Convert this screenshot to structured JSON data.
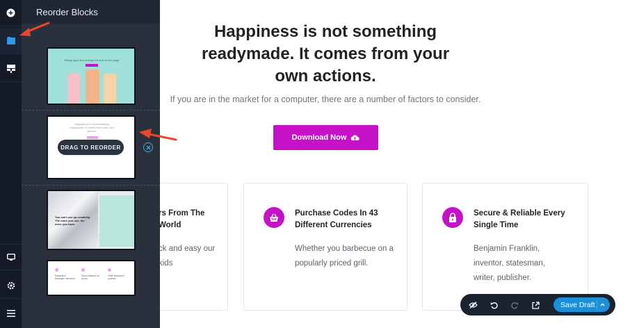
{
  "panel": {
    "title": "Reorder Blocks",
    "drag_label": "DRAG TO REORDER",
    "thumb1": {
      "headline": "Simply type and change the text on the page"
    },
    "thumb2": {
      "headline": "Happiness is not something readymade. It comes from your own actions."
    },
    "thumb3": {
      "headline": "You can't use up creativity. The more you use, the more you have."
    },
    "thumb4": {
      "items": [
        "Marketers Manager elements",
        "Show Alliance to prove",
        "Offer sustained policies"
      ]
    }
  },
  "rail": {
    "icons": [
      "add-icon",
      "blocks-icon",
      "layout-icon",
      "desktop-icon",
      "settings-icon",
      "menu-icon"
    ]
  },
  "main": {
    "headline": "Happiness is not something readymade. It comes from your own actions.",
    "subline": "If you are in the market for a computer, there are a number of factors to consider.",
    "download_label": "Download Now",
    "cards": [
      {
        "title": "rs From The World",
        "text": "ck and easy our kids"
      },
      {
        "title": "Purchase Codes In 43 Different Currencies",
        "text": "Whether you barbecue on a popularly priced grill."
      },
      {
        "title": "Secure & Reliable Every Single Time",
        "text": "Benjamin Franklin, inventor, statesman, writer, publisher."
      }
    ]
  },
  "toolbar": {
    "save_label": "Save Draft"
  },
  "colors": {
    "accent": "#c512c8",
    "save_blue": "#1c8fd9",
    "rail_bg": "#141b26",
    "panel_bg": "#2a313d",
    "arrow": "#e8472b"
  }
}
